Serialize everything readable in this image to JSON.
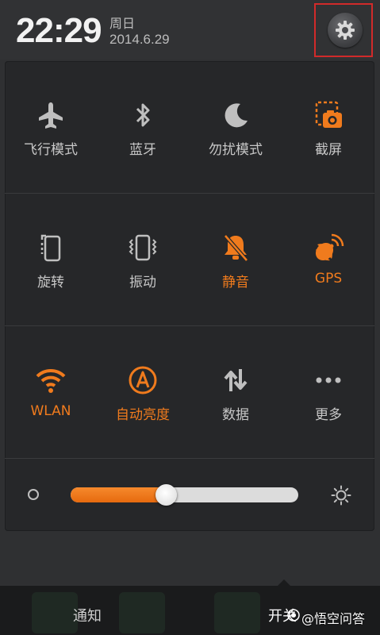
{
  "status_bar": {
    "time": "22:29",
    "weekday": "周日",
    "date": "2014.6.29"
  },
  "settings": {
    "icon": "gear-icon"
  },
  "accent_color": "#f07b1d",
  "toggles": [
    {
      "label": "飞行模式",
      "icon": "airplane-icon",
      "on": false
    },
    {
      "label": "蓝牙",
      "icon": "bluetooth-icon",
      "on": false
    },
    {
      "label": "勿扰模式",
      "icon": "moon-icon",
      "on": false
    },
    {
      "label": "截屏",
      "icon": "screenshot-icon",
      "on": false
    },
    {
      "label": "旋转",
      "icon": "rotate-icon",
      "on": false
    },
    {
      "label": "振动",
      "icon": "vibrate-icon",
      "on": false
    },
    {
      "label": "静音",
      "icon": "mute-bell-icon",
      "on": true
    },
    {
      "label": "GPS",
      "icon": "gps-icon",
      "on": true
    },
    {
      "label": "WLAN",
      "icon": "wifi-icon",
      "on": true
    },
    {
      "label": "自动亮度",
      "icon": "auto-brightness-icon",
      "on": true
    },
    {
      "label": "数据",
      "icon": "data-transfer-icon",
      "on": false
    },
    {
      "label": "更多",
      "icon": "more-icon",
      "on": false
    }
  ],
  "brightness": {
    "level": 0.42
  },
  "bottom_tabs": {
    "notifications": "通知",
    "toggles": "开关"
  },
  "watermark": "@悟空问答"
}
